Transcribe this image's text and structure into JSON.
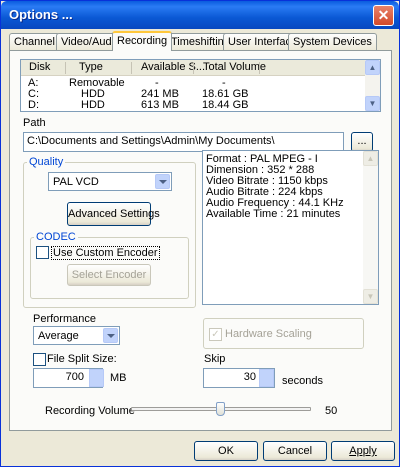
{
  "window": {
    "title": "Options ...",
    "close_glyph": "✕"
  },
  "tabs": [
    {
      "label": "Channel"
    },
    {
      "label": "Video/Audio"
    },
    {
      "label": "Recording"
    },
    {
      "label": "Timeshifting"
    },
    {
      "label": "User Interface"
    },
    {
      "label": "System Devices"
    }
  ],
  "active_tab": "Recording",
  "disk_table": {
    "columns": [
      "Disk",
      "Type",
      "Available S...",
      "Total Volume"
    ],
    "rows": [
      [
        "A:",
        "Removable",
        "-",
        "-"
      ],
      [
        "C:",
        "HDD",
        "241 MB",
        "18.61 GB"
      ],
      [
        "D:",
        "HDD",
        "613 MB",
        "18.44 GB"
      ]
    ]
  },
  "path": {
    "label": "Path",
    "value": "C:\\Documents and Settings\\Admin\\My Documents\\",
    "browse_label": "..."
  },
  "quality": {
    "group_label": "Quality",
    "selected": "PAL VCD",
    "advanced_button": "Advanced Settings",
    "codec": {
      "group_label": "CODEC",
      "use_custom_label": "Use Custom Encoder",
      "use_custom_checked": false,
      "select_encoder_label": "Select Encoder"
    }
  },
  "info_lines": [
    "Format : PAL MPEG - I",
    "Dimension : 352 * 288",
    "Video Bitrate : 1150 kbps",
    "Audio Bitrate : 224 kbps",
    "Audio Frequency : 44.1 KHz",
    "Available Time : 21 minutes"
  ],
  "performance": {
    "label": "Performance",
    "selected": "Average"
  },
  "hardware_scaling": {
    "label": "Hardware Scaling",
    "checked": true,
    "enabled": false
  },
  "file_split": {
    "label": "File Split Size:",
    "checked": false,
    "value": "700",
    "unit": "MB"
  },
  "skip": {
    "label": "Skip",
    "value": "30",
    "unit": "seconds"
  },
  "recording_volume": {
    "label": "Recording Volume",
    "value": "50",
    "level": 0.5
  },
  "footer": {
    "ok": "OK",
    "cancel": "Cancel",
    "apply": "Apply"
  },
  "icons": {
    "close": "close-icon",
    "dropdown": "chevron-down-icon",
    "scroll_up": "arrow-up-icon",
    "scroll_down": "arrow-down-icon"
  }
}
